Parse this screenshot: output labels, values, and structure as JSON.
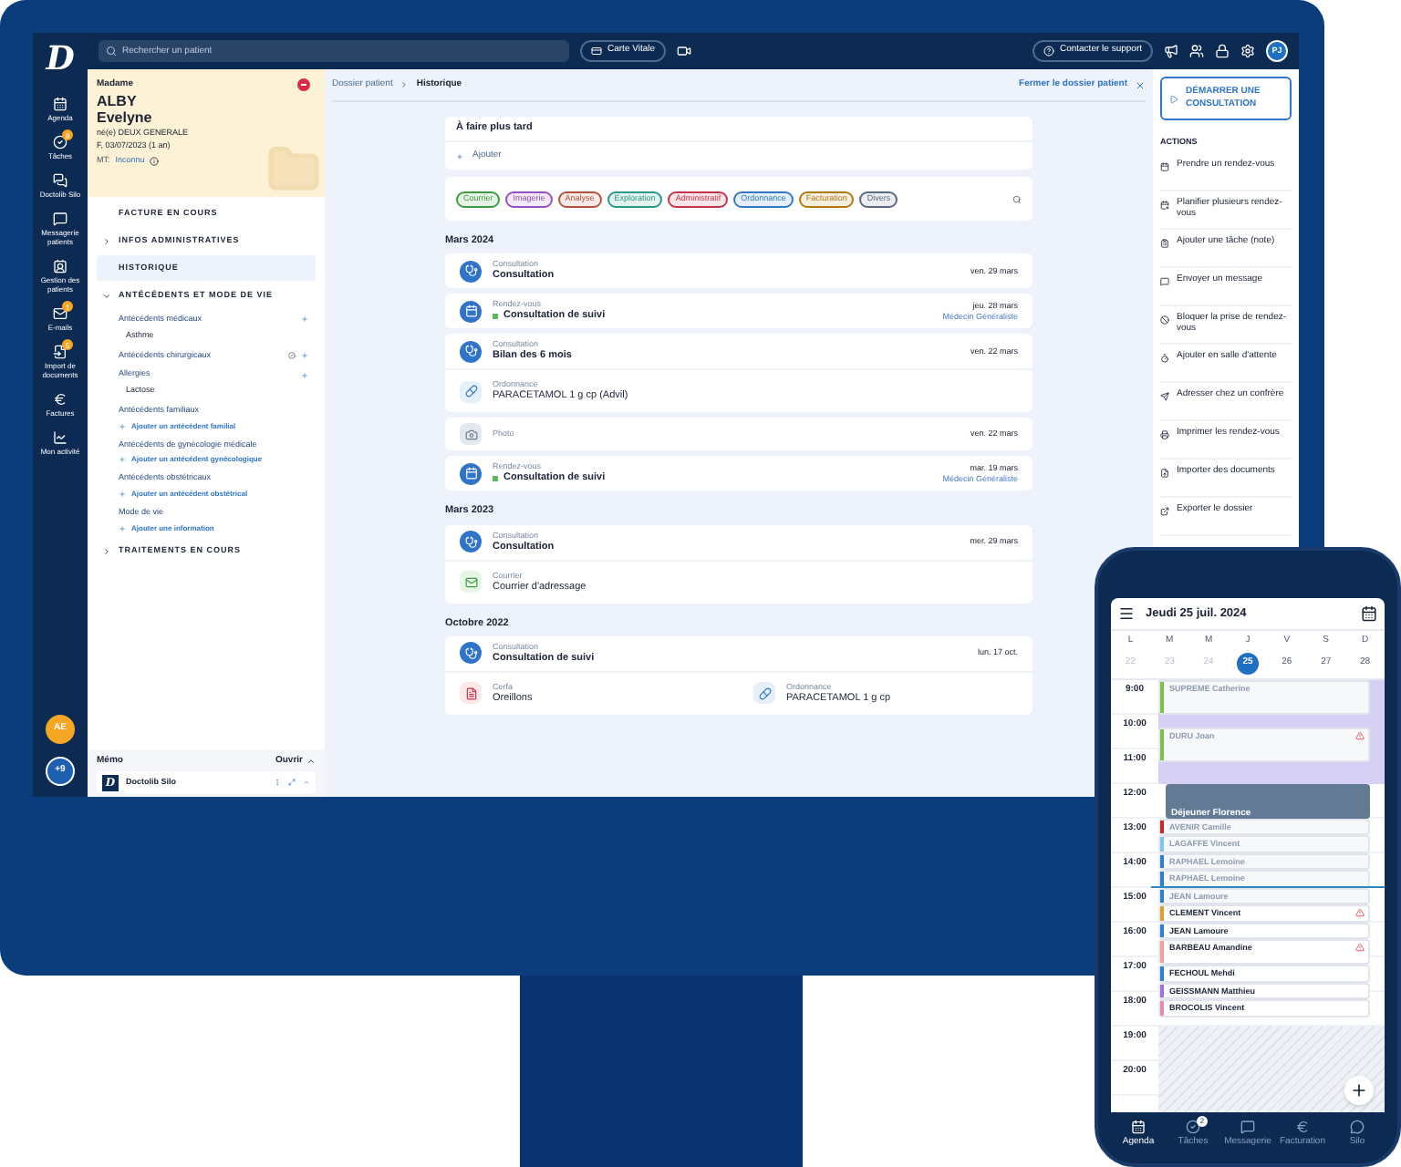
{
  "rail": {
    "logo": "D",
    "items": [
      {
        "label": "Agenda"
      },
      {
        "label": "Tâches",
        "badge": "9"
      },
      {
        "label": "Doctolib Silo"
      },
      {
        "label": "Messagerie patients"
      },
      {
        "label": "Gestion des patients"
      },
      {
        "label": "E-mails",
        "badge": "1"
      },
      {
        "label": "Import de documents",
        "badge": "5"
      },
      {
        "label": "Factures"
      },
      {
        "label": "Mon activité"
      }
    ],
    "user_initials": "AE",
    "more": "+9"
  },
  "topbar": {
    "search_placeholder": "Rechercher un patient",
    "carte_vitale": "Carte Vitale",
    "support": "Contacter le support",
    "user_initials": "PJ"
  },
  "patient": {
    "civility": "Madame",
    "last_name": "ALBY",
    "first_name": "Evelyne",
    "birth_name": "né(e) DEUX GENERALE",
    "details": "F, 03/07/2023 (1 an)",
    "mt_label": "MT:",
    "mt_value": "Inconnu"
  },
  "patient_menu": [
    {
      "label": "FACTURE EN COURS",
      "kind": "link",
      "selected": false
    },
    {
      "label": "INFOS ADMINISTRATIVES",
      "kind": "toggle",
      "expanded": false,
      "selected": false
    },
    {
      "label": "HISTORIQUE",
      "kind": "link",
      "selected": true
    },
    {
      "label": "ANTÉCÉDENTS ET MODE DE VIE",
      "kind": "toggle",
      "expanded": true,
      "selected": false
    }
  ],
  "antecedents": [
    {
      "title": "Antécédents médicaux",
      "entries": [
        "Asthme"
      ],
      "marked_none": false
    },
    {
      "title": "Antécédents chirurgicaux",
      "marked_none": true
    },
    {
      "title": "Allergies",
      "entries": [
        "Lactose"
      ],
      "marked_none": false
    },
    {
      "title": "Antécédents familiaux",
      "add_label": "Ajouter un antécédent familial",
      "marked_none": false
    },
    {
      "title": "Antécédents de gynécologie médicale",
      "add_label": "Ajouter un antécédent gynécologique",
      "marked_none": false
    },
    {
      "title": "Antécédents obstétricaux",
      "add_label": "Ajouter un antécédent obstétrical",
      "marked_none": false
    },
    {
      "title": "Mode de vie",
      "add_label": "Ajouter une information",
      "marked_none": false
    }
  ],
  "treatments": {
    "label": "TRAITEMENTS EN COURS",
    "expanded": false
  },
  "memo": {
    "title": "Mémo",
    "action": "Ouvrir"
  },
  "silo": {
    "logo": "D",
    "title": "Doctolib Silo"
  },
  "breadcrumb": [
    "Dossier patient",
    "Historique"
  ],
  "close_label": "Fermer le dossier patient",
  "todo": {
    "title": "À faire plus tard",
    "add": "Ajouter"
  },
  "filters": [
    {
      "label": "Courrier",
      "color": "#3f9a3f"
    },
    {
      "label": "Imagerie",
      "color": "#9a4fc0"
    },
    {
      "label": "Analyse",
      "color": "#b0533a"
    },
    {
      "label": "Exploration",
      "color": "#2a9a86"
    },
    {
      "label": "Administratif",
      "color": "#c8324a"
    },
    {
      "label": "Ordonnance",
      "color": "#2f7ac0"
    },
    {
      "label": "Facturation",
      "color": "#b07a10"
    },
    {
      "label": "Divers",
      "color": "#5a6a80"
    }
  ],
  "timeline": [
    {
      "month": "Mars 2024",
      "cards": [
        {
          "entries": [
            {
              "kind": "consultation",
              "type": "Consultation",
              "title": "Consultation",
              "date": "ven. 29 mars"
            }
          ]
        },
        {
          "entries": [
            {
              "kind": "appointment",
              "type": "Rendez-vous",
              "title": "Consultation de suivi",
              "date": "jeu. 28 mars",
              "specialty": "Médecin Généraliste"
            }
          ]
        },
        {
          "entries": [
            {
              "kind": "consultation",
              "type": "Consultation",
              "title": "Bilan des 6 mois",
              "date": "ven. 22 mars"
            }
          ],
          "attachments": [
            {
              "kind": "prescription",
              "type": "Ordonnance",
              "title": "PARACETAMOL 1 g cp (Advil)"
            }
          ]
        },
        {
          "entries": [
            {
              "kind": "photo",
              "type": "Photo",
              "date": "ven. 22 mars"
            }
          ]
        },
        {
          "entries": [
            {
              "kind": "appointment",
              "type": "Rendez-vous",
              "title": "Consultation de suivi",
              "date": "mar. 19 mars",
              "specialty": "Médecin Généraliste"
            }
          ]
        }
      ]
    },
    {
      "month": "Mars 2023",
      "cards": [
        {
          "entries": [
            {
              "kind": "consultation",
              "type": "Consultation",
              "title": "Consultation",
              "date": "mer. 29 mars"
            }
          ],
          "attachments": [
            {
              "kind": "letter",
              "type": "Courrier",
              "title": "Courrier d'adressage"
            }
          ]
        }
      ]
    },
    {
      "month": "Octobre 2022",
      "cards": [
        {
          "entries": [
            {
              "kind": "consultation",
              "type": "Consultation",
              "title": "Consultation de suivi",
              "date": "lun. 17 oct."
            }
          ],
          "attachments": [
            {
              "kind": "cerfa",
              "type": "Cerfa",
              "title": "Oreillons"
            },
            {
              "kind": "prescription",
              "type": "Ordonnance",
              "title": "PARACETAMOL 1 g cp"
            }
          ]
        }
      ]
    }
  ],
  "start_button": "DÉMARRER UNE CONSULTATION",
  "actions_title": "ACTIONS",
  "actions": [
    "Prendre un rendez-vous",
    "Planifier plusieurs rendez-vous",
    "Ajouter une tâche (note)",
    "Envoyer un message",
    "Bloquer la prise de rendez-vous",
    "Ajouter en salle d'attente",
    "Adresser chez un confrère",
    "Imprimer les rendez-vous",
    "Importer des documents",
    "Exporter le dossier"
  ],
  "phone": {
    "date_title": "Jeudi 25 juil. 2024",
    "days": [
      {
        "letter": "L",
        "day": "22",
        "past": true,
        "selected": false
      },
      {
        "letter": "M",
        "day": "23",
        "past": true,
        "selected": false
      },
      {
        "letter": "M",
        "day": "24",
        "past": true,
        "selected": false
      },
      {
        "letter": "J",
        "day": "25",
        "past": false,
        "selected": true
      },
      {
        "letter": "V",
        "day": "26",
        "past": false,
        "selected": false
      },
      {
        "letter": "S",
        "day": "27",
        "past": false,
        "selected": false
      },
      {
        "letter": "D",
        "day": "28",
        "past": false,
        "selected": false
      }
    ],
    "hours": [
      "9:00",
      "10:00",
      "11:00",
      "12:00",
      "13:00",
      "14:00",
      "15:00",
      "16:00",
      "17:00",
      "18:00",
      "19:00",
      "20:00"
    ],
    "events": [
      {
        "kind": "appointment",
        "name": "SUPREME Catherine",
        "color": "#7cc24a",
        "past": true,
        "alert": false
      },
      {
        "kind": "appointment",
        "name": "DURU Joan",
        "color": "#7cc24a",
        "past": true,
        "alert": true
      },
      {
        "kind": "break",
        "name": "Déjeuner Florence"
      },
      {
        "kind": "appointment",
        "name": "AVENIR Camille",
        "color": "#c62828",
        "past": true,
        "alert": false
      },
      {
        "kind": "appointment",
        "name": "LAGAFFE Vincent",
        "color": "#7ec8f0",
        "past": true,
        "alert": false
      },
      {
        "kind": "appointment",
        "name": "RAPHAEL Lemoine",
        "color": "#2f7fd0",
        "past": true,
        "alert": false
      },
      {
        "kind": "appointment",
        "name": "RAPHAEL Lemoine",
        "color": "#2f7fd0",
        "past": true,
        "alert": false
      },
      {
        "kind": "appointment",
        "name": "JEAN Lamoure",
        "color": "#2f7fd0",
        "past": true,
        "alert": false
      },
      {
        "kind": "appointment",
        "name": "CLEMENT Vincent",
        "color": "#e0a030",
        "past": false,
        "alert": true
      },
      {
        "kind": "appointment",
        "name": "JEAN Lamoure",
        "color": "#2f7fd0",
        "past": false,
        "alert": false
      },
      {
        "kind": "appointment",
        "name": "BARBEAU Amandine",
        "color": "#f4a0a0",
        "past": false,
        "alert": true
      },
      {
        "kind": "appointment",
        "name": "FECHOUL Mehdi",
        "color": "#2f7fd0",
        "past": false,
        "alert": false
      },
      {
        "kind": "appointment",
        "name": "GEISSMANN Matthieu",
        "color": "#a070e0",
        "past": false,
        "alert": false
      },
      {
        "kind": "appointment",
        "name": "BROCOLIS Vincent",
        "color": "#e88ab0",
        "past": false,
        "alert": false
      }
    ],
    "tabs": [
      {
        "label": "Agenda",
        "selected": true
      },
      {
        "label": "Tâches",
        "badge": "2",
        "selected": false
      },
      {
        "label": "Messagerie",
        "selected": false
      },
      {
        "label": "Facturation",
        "selected": false
      },
      {
        "label": "Silo",
        "selected": false
      }
    ]
  }
}
